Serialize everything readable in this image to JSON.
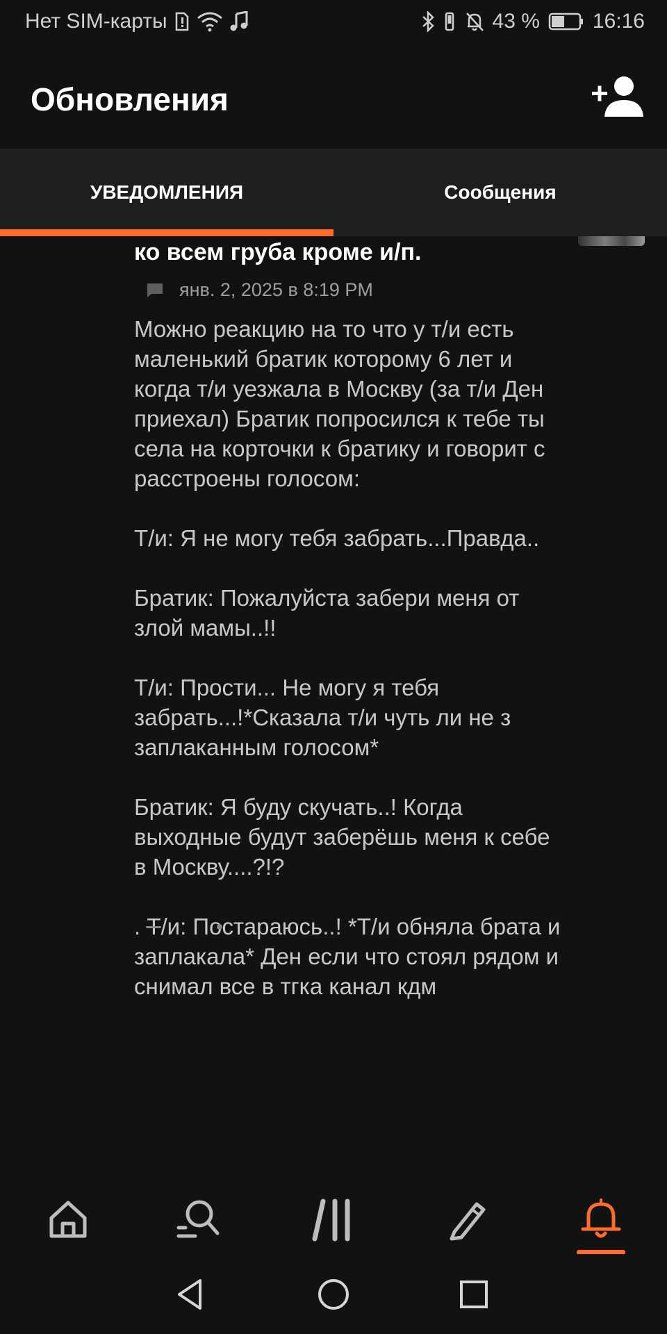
{
  "status_bar": {
    "carrier": "Нет SIM-карты",
    "battery_percent": "43 %",
    "time": "16:16",
    "icons": [
      "sim-alert-icon",
      "wifi-icon",
      "music-note-icon",
      "bluetooth-icon",
      "vibrate-icon",
      "bell-off-icon",
      "battery-icon"
    ]
  },
  "header": {
    "title": "Обновления",
    "add_user_icon": "add-user-icon"
  },
  "tabs": [
    {
      "label": "УВЕДОМЛЕНИЯ",
      "active": true
    },
    {
      "label": "Сообщения",
      "active": false
    }
  ],
  "colors": {
    "accent": "#ff6d2d",
    "background": "#121212",
    "tab_bar": "#1e1e1e",
    "body_text": "#c8c8c8",
    "meta_text": "#9e9e9e"
  },
  "post": {
    "title": "ко всем груба кроме и/п.",
    "meta_icon": "comment-icon",
    "date": "янв. 2, 2025 в 8:19 PM",
    "body": "Можно реакцию на то что у т/и есть маленький братик которому 6 лет и когда т/и уезжала в Москву (за т/и Ден приехал) Братик попросился к тебе ты села на корточки к братику и говорит с расстроены голосом:\n\nТ/и: Я не могу тебя забрать...Правда..\n\n Братик: Пожалуйста забери меня от злой мамы..!!\n\nТ/и: Прости... Не могу я тебя забрать...!*Сказала т/и чуть ли не з заплаканным голосом*\n\nБратик: Я буду скучать..! Когда выходные будут заберёшь меня к себе в Москву....?!?\n\n. Т/и: Постараюсь..! *Т/и обняла брата и заплакала* Ден если что стоял рядом и снимал все в тгка канал кдм"
  },
  "bottom_nav": [
    {
      "icon": "home-icon",
      "active": false
    },
    {
      "icon": "search-icon",
      "active": false
    },
    {
      "icon": "feed-icon",
      "active": false
    },
    {
      "icon": "pencil-icon",
      "active": false
    },
    {
      "icon": "bell-icon",
      "active": true
    }
  ],
  "system_nav": [
    "back-icon",
    "home-circle-icon",
    "recents-icon"
  ]
}
